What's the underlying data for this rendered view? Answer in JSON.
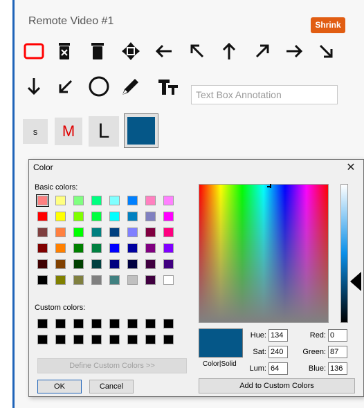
{
  "window": {
    "title": "Remote Video #1",
    "shrink_label": "Shrink"
  },
  "tools": [
    {
      "name": "rectangle-tool",
      "icon": "red-rectangle-icon"
    },
    {
      "name": "delete-selected-tool",
      "icon": "trash-x-icon"
    },
    {
      "name": "delete-all-tool",
      "icon": "trash-icon"
    },
    {
      "name": "move-tool",
      "icon": "move-arrows-icon"
    },
    {
      "name": "arrow-left-tool",
      "icon": "arrow-left-icon"
    },
    {
      "name": "arrow-up-left-tool",
      "icon": "arrow-up-left-icon"
    },
    {
      "name": "arrow-up-tool",
      "icon": "arrow-up-icon"
    },
    {
      "name": "arrow-up-right-tool",
      "icon": "arrow-up-right-icon"
    },
    {
      "name": "arrow-right-tool",
      "icon": "arrow-right-icon"
    },
    {
      "name": "arrow-down-right-tool",
      "icon": "arrow-down-right-icon"
    },
    {
      "name": "arrow-down-tool",
      "icon": "arrow-down-icon"
    },
    {
      "name": "arrow-down-left-tool",
      "icon": "arrow-down-left-icon"
    },
    {
      "name": "circle-tool",
      "icon": "circle-icon"
    },
    {
      "name": "pen-tool",
      "icon": "pen-icon"
    },
    {
      "name": "text-tool",
      "icon": "text-size-icon"
    }
  ],
  "text_annotation": {
    "placeholder": "Text Box Annotation"
  },
  "sizes": {
    "small": "s",
    "medium": "M",
    "large": "L"
  },
  "current_color": "#055788",
  "dialog": {
    "title": "Color",
    "basic_label": "Basic colors:",
    "custom_label": "Custom colors:",
    "define_label": "Define Custom Colors >>",
    "ok_label": "OK",
    "cancel_label": "Cancel",
    "color_solid_label": "Color|Solid",
    "add_custom_label": "Add to Custom Colors",
    "hue_label": "Hue:",
    "sat_label": "Sat:",
    "lum_label": "Lum:",
    "red_label": "Red:",
    "green_label": "Green:",
    "blue_label": "Blue:",
    "hue": "134",
    "sat": "240",
    "lum": "64",
    "red": "0",
    "green": "87",
    "blue": "136",
    "basic_colors": [
      "#ff8080",
      "#ffff80",
      "#80ff80",
      "#00ff80",
      "#80ffff",
      "#0080ff",
      "#ff80c0",
      "#ff80ff",
      "#ff0000",
      "#ffff00",
      "#80ff00",
      "#00ff40",
      "#00ffff",
      "#0080c0",
      "#8080c0",
      "#ff00ff",
      "#804040",
      "#ff8040",
      "#00ff00",
      "#008080",
      "#004080",
      "#8080ff",
      "#800040",
      "#ff0080",
      "#800000",
      "#ff8000",
      "#008000",
      "#008040",
      "#0000ff",
      "#0000a0",
      "#800080",
      "#8000ff",
      "#400000",
      "#804000",
      "#004000",
      "#004040",
      "#000080",
      "#000040",
      "#400040",
      "#400080",
      "#000000",
      "#808000",
      "#808040",
      "#808080",
      "#408080",
      "#c0c0c0",
      "#400040",
      "#ffffff"
    ],
    "custom_colors": [
      "#000000",
      "#000000",
      "#000000",
      "#000000",
      "#000000",
      "#000000",
      "#000000",
      "#000000",
      "#000000",
      "#000000",
      "#000000",
      "#000000",
      "#000000",
      "#000000",
      "#000000",
      "#000000"
    ]
  }
}
